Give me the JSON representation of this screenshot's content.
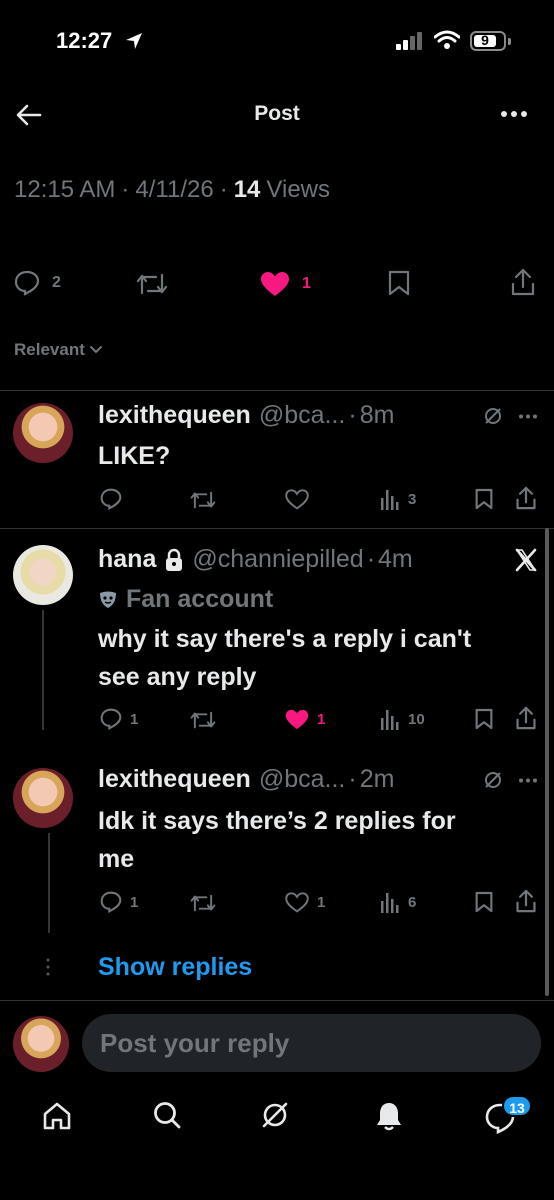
{
  "status_bar": {
    "time": "12:27",
    "battery": "9"
  },
  "header": {
    "title": "Post"
  },
  "post": {
    "time": "12:15 AM",
    "sep": "·",
    "date": "4/11/26",
    "views_count": "14",
    "views_label": "Views",
    "replies": "2",
    "likes": "1"
  },
  "sort": {
    "label": "Relevant"
  },
  "replies": [
    {
      "name": "lexithequeen",
      "handle": "@bca...",
      "time": "8m",
      "text": "LIKE?",
      "views": "3"
    },
    {
      "name": "hana",
      "handle": "@channiepilled",
      "time": "4m",
      "badge": "Fan account",
      "text_line1": "why it say there's a reply i can't",
      "text_line2": "see any reply",
      "replies": "1",
      "likes": "1",
      "views": "10"
    },
    {
      "name": "lexithequeen",
      "handle": "@bca...",
      "time": "2m",
      "text_line1": "Idk it says there’s 2 replies for",
      "text_line2": "me",
      "replies": "1",
      "likes": "1",
      "views": "6"
    }
  ],
  "show_replies": "Show replies",
  "composer": {
    "placeholder": "Post your reply"
  },
  "tab_bar": {
    "messages_badge": "13"
  },
  "colors": {
    "accent": "#1d9bf0",
    "like": "#f91880",
    "muted": "#71767b",
    "background": "#000000"
  }
}
